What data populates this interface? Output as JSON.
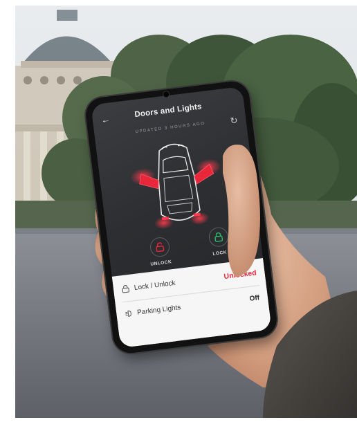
{
  "colors": {
    "accent_red": "#e8283a",
    "lock_green": "#2fb86a",
    "screen_bg": "#2c2e31"
  },
  "app": {
    "title": "Doors and Lights",
    "updated": "UPDATED 3 HOURS AGO",
    "icons": {
      "back": "arrow-left-icon",
      "refresh": "refresh-icon"
    }
  },
  "controls": {
    "unlock_label": "UNLOCK",
    "lock_label": "LOCK"
  },
  "rows": [
    {
      "label": "Lock / Unlock",
      "value": "Unlocked",
      "icon": "lock-icon"
    },
    {
      "label": "Parking Lights",
      "value": "Off",
      "icon": "parking-light-icon"
    }
  ]
}
